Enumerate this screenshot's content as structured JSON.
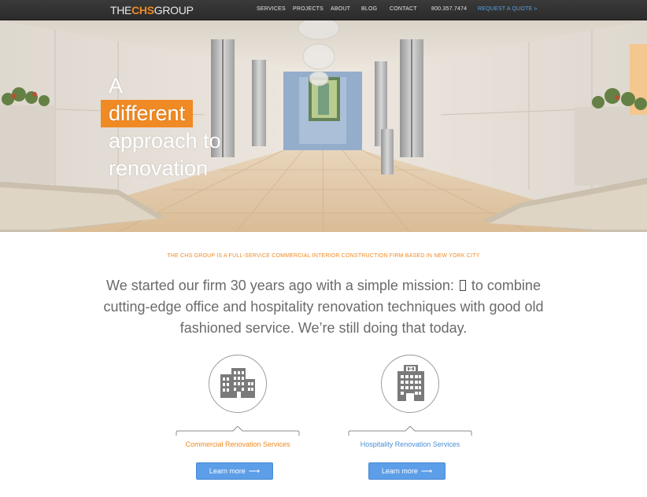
{
  "header": {
    "logo": {
      "pre": "THE",
      "mid": "CHS",
      "post": "GROUP"
    },
    "nav": [
      {
        "label": "SERVICES"
      },
      {
        "label": "PROJECTS"
      },
      {
        "label": "ABOUT"
      },
      {
        "label": "BLOG"
      },
      {
        "label": "CONTACT"
      }
    ],
    "phone": "800.357.7474",
    "quote": "REQUEST A QUOTE »"
  },
  "hero": {
    "line1": "A",
    "highlight": "different",
    "line3": "approach to",
    "line4": "renovation"
  },
  "intro": {
    "tagline": "THE CHS GROUP IS A FULL-SERVICE COMMERCIAL INTERIOR CONSTRUCTION FIRM BASED IN NEW YORK CITY",
    "mission_part1": "We started our firm 30 years ago with a simple mission:",
    "mission_part2": "to combine cutting-edge office and hospitality renovation techniques with good old fashioned service. We’re still doing that today."
  },
  "services": [
    {
      "title": "Commercial Renovation Services",
      "button": "Learn more",
      "icon": "office-buildings-icon",
      "color": "#f08a24"
    },
    {
      "title": "Hospitality Renovation Services",
      "button": "Learn more",
      "icon": "hotel-building-icon",
      "color": "#4a8fd6"
    }
  ],
  "colors": {
    "accent": "#f08a24",
    "link": "#4a8fd6",
    "button": "#5c9ee8",
    "nav_bg": "#333333"
  }
}
